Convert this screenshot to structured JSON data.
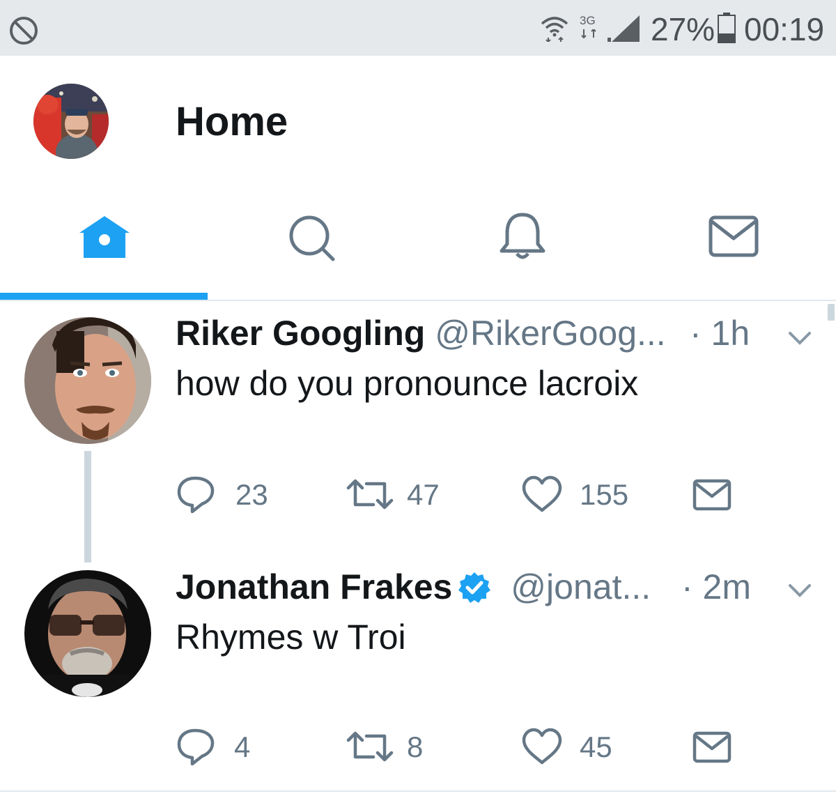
{
  "status_bar": {
    "network_label": "3G",
    "battery_percent": "27%",
    "time": "00:19",
    "icons": [
      "block-icon",
      "wifi-icon",
      "signal-icon",
      "battery-icon"
    ]
  },
  "header": {
    "title": "Home"
  },
  "tabs": [
    {
      "name": "home",
      "icon": "home-icon",
      "active": true
    },
    {
      "name": "search",
      "icon": "search-icon",
      "active": false
    },
    {
      "name": "notifications",
      "icon": "bell-icon",
      "active": false
    },
    {
      "name": "messages",
      "icon": "mail-icon",
      "active": false
    }
  ],
  "tweets": [
    {
      "name": "Riker Googling",
      "handle": "@RikerGoog...",
      "time": "· 1h",
      "text": "how do you pronounce lacroix",
      "verified": false,
      "replies": "23",
      "retweets": "47",
      "likes": "155"
    },
    {
      "name": "Jonathan Frakes",
      "handle": "@jonat...",
      "time": "· 2m",
      "text": "Rhymes w Troi",
      "verified": true,
      "replies": "4",
      "retweets": "8",
      "likes": "45"
    }
  ],
  "colors": {
    "accent": "#1da1f2",
    "icon_gray": "#657786",
    "status_bar_bg": "#e6e9ec"
  }
}
